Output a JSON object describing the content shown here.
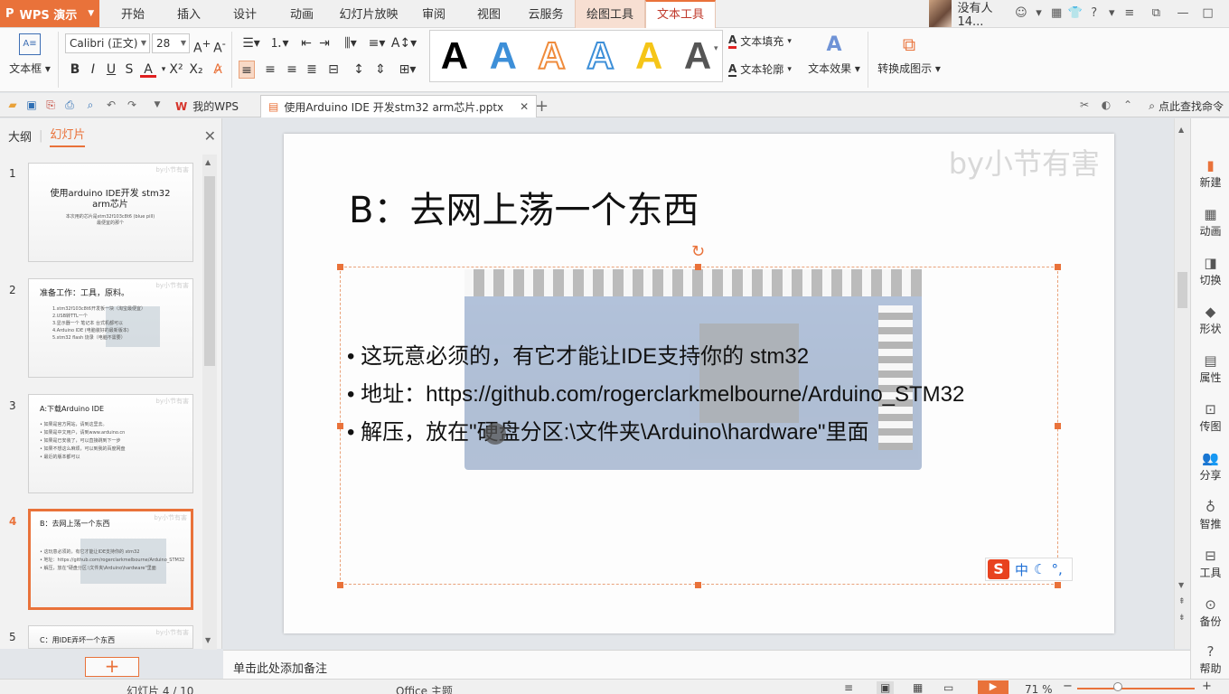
{
  "app": {
    "name": "WPS 演示"
  },
  "menu_tabs": [
    "开始",
    "插入",
    "设计",
    "动画",
    "幻灯片放映",
    "审阅",
    "视图",
    "云服务",
    "绘图工具",
    "文本工具"
  ],
  "user": {
    "name": "没有人14..."
  },
  "ribbon": {
    "textbox_label": "文本框",
    "font_name": "Calibri (正文)",
    "font_size": "28",
    "text_fill": "文本填充",
    "text_outline": "文本轮廓",
    "text_effect": "文本效果",
    "convert_label": "转换成图示",
    "style_colors": [
      "#000000",
      "#3d8fd8",
      "#ef8b3c",
      "#3d8fd8",
      "#f5c518",
      "#555555"
    ]
  },
  "quickbar": {
    "tab_mywps": "我的WPS",
    "tab_doc": "使用Arduino IDE 开发stm32 arm芯片.pptx",
    "search": "点此查找命令"
  },
  "left_pane": {
    "tab_outline": "大纲",
    "tab_slides": "幻灯片",
    "thumbs": [
      {
        "num": "1",
        "title": "使用arduino IDE开发 stm32 arm芯片",
        "sub": "本次用的芯片是stm32f103c8t6 (blue pill)最便宜的那个"
      },
      {
        "num": "2",
        "title": "准备工作：工具，原料。",
        "lines": [
          "1.stm32f103c8t6开发板一块（淘宝最便宜）",
          "2.USB转TTL一个",
          "3.显示器一个 笔记本 台式机都可以",
          "4.Arduino IDE (电脑装好的最新版本)",
          "5.stm32 flash 烧录（电脑不需要）"
        ]
      },
      {
        "num": "3",
        "title": "A:下载Arduino IDE",
        "lines": [
          "• 如果是官方网站，请到这里去。",
          "• 如果是中文用户，请到www.arduino.cn",
          "• 如果是已安装了，可以直接跳到下一步",
          "• 如果不想这么麻烦，可以到我的百度网盘",
          "• 最近的版本都可以"
        ]
      },
      {
        "num": "4",
        "title": "B：去网上荡一个东西",
        "lines": [
          "• 这玩意必须的，有它才能让IDE支持你的 stm32",
          "• 地址：https://github.com/rogerclarkmelbourne/Arduino_STM32",
          "• 解压，放在\"硬盘分区:\\文件夹\\Arduino\\hardware\"里面"
        ]
      },
      {
        "num": "5",
        "title": "C：用IDE弄坏一个东西"
      }
    ]
  },
  "slide": {
    "watermark": "by小节有害",
    "thumb_watermark": "by小节有害",
    "title": "B：去网上荡一个东西",
    "bullets": [
      "• 这玩意必须的，有它才能让IDE支持你的 stm32",
      "• 地址：https://github.com/rogerclarkmelbourne/Arduino_STM32",
      "• 解压，放在\"硬盘分区:\\文件夹\\Arduino\\hardware\"里面"
    ]
  },
  "ime": {
    "label": "中"
  },
  "right_bar": [
    "新建",
    "动画",
    "切换",
    "形状",
    "属性",
    "传图",
    "分享",
    "智推",
    "工具",
    "备份",
    "帮助"
  ],
  "notes": {
    "placeholder": "单击此处添加备注"
  },
  "status": {
    "slide_info": "幻灯片 4 / 10",
    "theme": "Office 主题",
    "zoom": "71 %"
  }
}
